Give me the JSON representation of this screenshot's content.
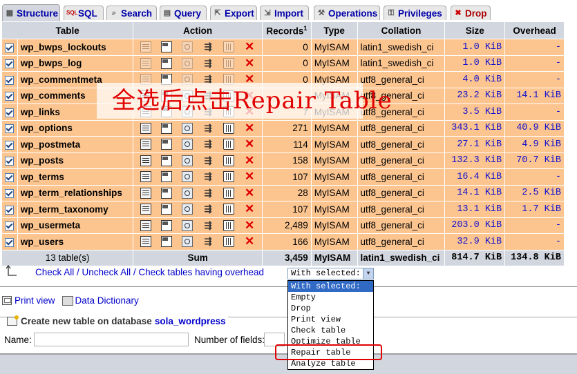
{
  "tabs": [
    {
      "label": "Structure",
      "icon": "structure-icon",
      "active": true
    },
    {
      "label": "SQL",
      "icon": "sql-icon"
    },
    {
      "label": "Search",
      "icon": "search-icon"
    },
    {
      "label": "Query",
      "icon": "query-icon"
    },
    {
      "label": "Export",
      "icon": "export-icon"
    },
    {
      "label": "Import",
      "icon": "import-icon"
    },
    {
      "label": "Operations",
      "icon": "operations-icon"
    },
    {
      "label": "Privileges",
      "icon": "privileges-icon"
    },
    {
      "label": "Drop",
      "icon": "drop-icon"
    }
  ],
  "table_headers": {
    "table": "Table",
    "action": "Action",
    "records": "Records",
    "records_sup": "1",
    "type": "Type",
    "collation": "Collation",
    "size": "Size",
    "overhead": "Overhead"
  },
  "rows": [
    {
      "name": "wp_bwps_lockouts",
      "records": "0",
      "type": "MyISAM",
      "collation": "latin1_swedish_ci",
      "size": "1.0 KiB",
      "overhead": "-",
      "empty": true
    },
    {
      "name": "wp_bwps_log",
      "records": "0",
      "type": "MyISAM",
      "collation": "latin1_swedish_ci",
      "size": "1.0 KiB",
      "overhead": "-",
      "empty": true
    },
    {
      "name": "wp_commentmeta",
      "records": "0",
      "type": "MyISAM",
      "collation": "utf8_general_ci",
      "size": "4.0 KiB",
      "overhead": "-",
      "empty": true
    },
    {
      "name": "wp_comments",
      "records": "",
      "type": "MyISAM",
      "collation": "utf8_general_ci",
      "size": "23.2 KiB",
      "overhead": "14.1 KiB",
      "empty": false
    },
    {
      "name": "wp_links",
      "records": "7",
      "type": "MyISAM",
      "collation": "utf8_general_ci",
      "size": "3.5 KiB",
      "overhead": "-",
      "empty": false
    },
    {
      "name": "wp_options",
      "records": "271",
      "type": "MyISAM",
      "collation": "utf8_general_ci",
      "size": "343.1 KiB",
      "overhead": "40.9 KiB",
      "empty": false
    },
    {
      "name": "wp_postmeta",
      "records": "114",
      "type": "MyISAM",
      "collation": "utf8_general_ci",
      "size": "27.1 KiB",
      "overhead": "4.9 KiB",
      "empty": false
    },
    {
      "name": "wp_posts",
      "records": "158",
      "type": "MyISAM",
      "collation": "utf8_general_ci",
      "size": "132.3 KiB",
      "overhead": "70.7 KiB",
      "empty": false
    },
    {
      "name": "wp_terms",
      "records": "107",
      "type": "MyISAM",
      "collation": "utf8_general_ci",
      "size": "16.4 KiB",
      "overhead": "-",
      "empty": false
    },
    {
      "name": "wp_term_relationships",
      "records": "28",
      "type": "MyISAM",
      "collation": "utf8_general_ci",
      "size": "14.1 KiB",
      "overhead": "2.5 KiB",
      "empty": false
    },
    {
      "name": "wp_term_taxonomy",
      "records": "107",
      "type": "MyISAM",
      "collation": "utf8_general_ci",
      "size": "13.1 KiB",
      "overhead": "1.7 KiB",
      "empty": false
    },
    {
      "name": "wp_usermeta",
      "records": "2,489",
      "type": "MyISAM",
      "collation": "utf8_general_ci",
      "size": "203.0 KiB",
      "overhead": "-",
      "empty": false
    },
    {
      "name": "wp_users",
      "records": "166",
      "type": "MyISAM",
      "collation": "utf8_general_ci",
      "size": "32.9 KiB",
      "overhead": "-",
      "empty": false
    }
  ],
  "footer": {
    "count": "13 table(s)",
    "sum_label": "Sum",
    "records": "3,459",
    "type": "MyISAM",
    "collation": "latin1_swedish_ci",
    "size": "814.7 KiB",
    "overhead": "134.8 KiB"
  },
  "overlay_text": "全选后点击Repair Table",
  "check_links": {
    "check_all": "Check All",
    "uncheck_all": "Uncheck All",
    "check_overhead": "Check tables having overhead",
    "separator": " / "
  },
  "with_selected": {
    "value": "With selected:",
    "options": [
      "With selected:",
      "Empty",
      "Drop",
      "Print view",
      "Check table",
      "Optimize table",
      "Repair table",
      "Analyze table"
    ],
    "highlighted_index": 0
  },
  "print_view": "Print view",
  "data_dictionary": "Data Dictionary",
  "create_table": {
    "legend": "Create new table on database",
    "database": "sola_wordpress",
    "name_label": "Name:",
    "fields_label": "Number of fields:"
  },
  "colors": {
    "row_bg": "#fcc590",
    "header_bg": "#d2d6de",
    "link": "#0000cc",
    "annotation": "#e00000"
  }
}
